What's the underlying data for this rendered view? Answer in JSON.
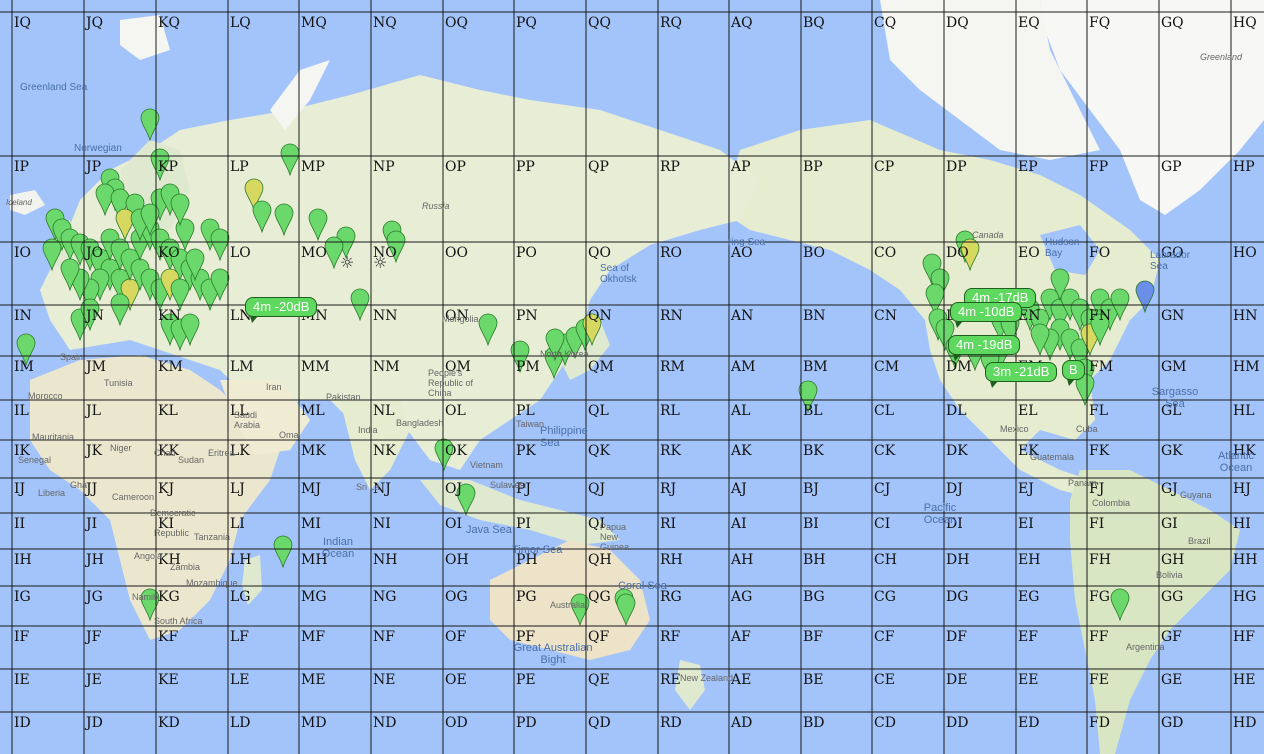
{
  "map": {
    "rows": [
      [
        "IQ",
        "JQ",
        "KQ",
        "LQ",
        "MQ",
        "NQ",
        "OQ",
        "PQ",
        "QQ",
        "RQ",
        "AQ",
        "BQ",
        "CQ",
        "DQ",
        "EQ",
        "FQ",
        "GQ",
        "HQ"
      ],
      [
        "IP",
        "JP",
        "KP",
        "LP",
        "MP",
        "NP",
        "OP",
        "PP",
        "QP",
        "RP",
        "AP",
        "BP",
        "CP",
        "DP",
        "EP",
        "FP",
        "GP",
        "HP"
      ],
      [
        "IO",
        "JO",
        "KO",
        "LO",
        "MO",
        "NO",
        "OO",
        "PO",
        "QO",
        "RO",
        "AO",
        "BO",
        "CO",
        "DO",
        "EO",
        "FO",
        "GO",
        "HO"
      ],
      [
        "IN",
        "JN",
        "KN",
        "LN",
        "MN",
        "NN",
        "ON",
        "PN",
        "QN",
        "RN",
        "AN",
        "BN",
        "CN",
        "DN",
        "EN",
        "FN",
        "GN",
        "HN"
      ],
      [
        "IM",
        "JM",
        "KM",
        "LM",
        "MM",
        "NM",
        "OM",
        "PM",
        "QM",
        "RM",
        "AM",
        "BM",
        "CM",
        "DM",
        "EM",
        "FM",
        "GM",
        "HM"
      ],
      [
        "IL",
        "JL",
        "KL",
        "LL",
        "ML",
        "NL",
        "OL",
        "PL",
        "QL",
        "RL",
        "AL",
        "BL",
        "CL",
        "DL",
        "EL",
        "FL",
        "GL",
        "HL"
      ],
      [
        "IK",
        "JK",
        "KK",
        "LK",
        "MK",
        "NK",
        "OK",
        "PK",
        "QK",
        "RK",
        "AK",
        "BK",
        "CK",
        "DK",
        "EK",
        "FK",
        "GK",
        "HK"
      ],
      [
        "IJ",
        "JJ",
        "KJ",
        "LJ",
        "MJ",
        "NJ",
        "OJ",
        "PJ",
        "QJ",
        "RJ",
        "AJ",
        "BJ",
        "CJ",
        "DJ",
        "EJ",
        "FJ",
        "GJ",
        "HJ"
      ],
      [
        "II",
        "JI",
        "KI",
        "LI",
        "MI",
        "NI",
        "OI",
        "PI",
        "QI",
        "RI",
        "AI",
        "BI",
        "CI",
        "DI",
        "EI",
        "FI",
        "GI",
        "HI"
      ],
      [
        "IH",
        "JH",
        "KH",
        "LH",
        "MH",
        "NH",
        "OH",
        "PH",
        "QH",
        "RH",
        "AH",
        "BH",
        "CH",
        "DH",
        "EH",
        "FH",
        "GH",
        "HH"
      ],
      [
        "IG",
        "JG",
        "KG",
        "LG",
        "MG",
        "NG",
        "OG",
        "PG",
        "QG",
        "RG",
        "AG",
        "BG",
        "CG",
        "DG",
        "EG",
        "FG",
        "GG",
        "HG"
      ],
      [
        "IF",
        "JF",
        "KF",
        "LF",
        "MF",
        "NF",
        "OF",
        "PF",
        "QF",
        "RF",
        "AF",
        "BF",
        "CF",
        "DF",
        "EF",
        "FF",
        "GF",
        "HF"
      ],
      [
        "IE",
        "JE",
        "KE",
        "LE",
        "ME",
        "NE",
        "OE",
        "PE",
        "QE",
        "RE",
        "AE",
        "BE",
        "CE",
        "DE",
        "EE",
        "FE",
        "GE",
        "HE"
      ],
      [
        "ID",
        "JD",
        "KD",
        "LD",
        "MD",
        "ND",
        "OD",
        "PD",
        "QD",
        "RD",
        "AD",
        "BD",
        "CD",
        "DD",
        "ED",
        "FD",
        "GD",
        "HD"
      ]
    ],
    "places": {
      "greenland_sea": "Greenland Sea",
      "greenland": "Greenland",
      "norwegian": "Norwegian",
      "iceland": "Iceland",
      "russia": "Russia",
      "sea_of_okhotsk": "Sea of Okhotsk",
      "bering_sea": "ring Sea",
      "canada": "Canada",
      "hudson_bay": "Hudson Bay",
      "labrador_sea": "Labrador Sea",
      "mongolia": "Mongolia",
      "china": "People's Republic of China",
      "north_korea": "North Korea",
      "tunisia": "Tunisia",
      "morocco": "Morocco",
      "iran": "Iran",
      "pakistan": "Pakistan",
      "saudi_arabia": "Saudi Arabia",
      "oman": "Oma",
      "india": "India",
      "bangladesh": "Bangladesh",
      "taiwan": "Taiwan",
      "philippine_sea": "Philippine Sea",
      "vietnam": "Vietnam",
      "mauritania": "Mauritania",
      "senegal": "Senegal",
      "niger": "Niger",
      "sudan": "Sudan",
      "eritrea": "Eritrea",
      "chad": "Chad",
      "liberia": "Liberia",
      "ghana": "Gha",
      "cameroon": "Cameroon",
      "democratic": "Democratic",
      "republic": "Republic",
      "tanzania": "Tanzania",
      "angola": "Angola",
      "zambia": "Zambia",
      "mozambique": "Mozambique",
      "namibia": "Namib",
      "south_africa": "South Africa",
      "sulawesi": "Sulawesi",
      "java_sea": "Java Sea",
      "timor_sea": "Timor Sea",
      "papua": "Papua New Guinea",
      "coral_sea": "Coral Sea",
      "australia": "Australia",
      "great_australian_bight": "Great Australian Bight",
      "new_zealand": "New Zealand",
      "indian_ocean": "Indian Ocean",
      "pacific_ocean": "Pacific Ocean",
      "sargasso_sea": "Sargasso Sea",
      "mexico": "Mexico",
      "cuba": "Cuba",
      "guatemala": "Guatemala",
      "panama": "Panam",
      "colombia": "Colombia",
      "guyana": "Guyana",
      "brazil": "Brazil",
      "bolivia": "Bolivia",
      "argentina": "Argentina",
      "atlantic_ocean": "Atlantic Ocean",
      "sri_lanka": "Sri La",
      "spain": "Spain"
    },
    "spots": [
      {
        "text": "4m -20dB"
      },
      {
        "text": "4m -17dB"
      },
      {
        "text": "4m -10dB"
      },
      {
        "text": "4m -19dB"
      },
      {
        "text": "3m -21dB"
      },
      {
        "text": "B"
      }
    ],
    "colors": {
      "water": "#a3c4fb",
      "land": "#e9efd8",
      "grid": "#000000",
      "marker": "#6ad86a",
      "marker_edge": "#2b8a2b",
      "spot_bg": "#5fd85f"
    }
  }
}
